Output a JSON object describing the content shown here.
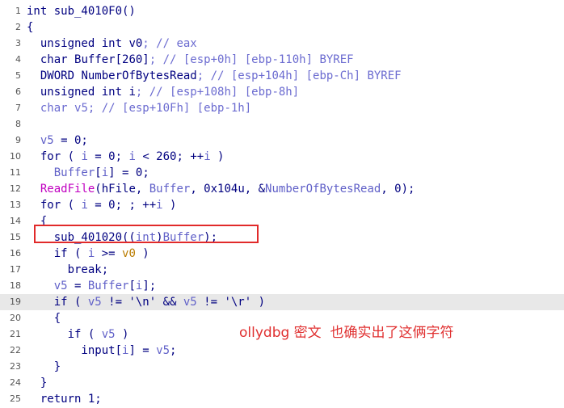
{
  "lines": [
    {
      "num": "1",
      "tokens": [
        {
          "t": "int sub_4010F0()",
          "c": "kw"
        }
      ]
    },
    {
      "num": "2",
      "tokens": [
        {
          "t": "{",
          "c": "op"
        }
      ]
    },
    {
      "num": "3",
      "tokens": [
        {
          "t": "  unsigned int ",
          "c": "kw"
        },
        {
          "t": "v0",
          "c": "id"
        },
        {
          "t": "; // eax",
          "c": "cmt"
        }
      ]
    },
    {
      "num": "4",
      "tokens": [
        {
          "t": "  char ",
          "c": "kw"
        },
        {
          "t": "Buffer[260]",
          "c": "id"
        },
        {
          "t": "; // [esp+0h] [ebp-110h] BYREF",
          "c": "cmt"
        }
      ]
    },
    {
      "num": "5",
      "tokens": [
        {
          "t": "  DWORD ",
          "c": "kw"
        },
        {
          "t": "NumberOfBytesRead",
          "c": "id"
        },
        {
          "t": "; // [esp+104h] [ebp-Ch] BYREF",
          "c": "cmt"
        }
      ]
    },
    {
      "num": "6",
      "tokens": [
        {
          "t": "  unsigned int ",
          "c": "kw"
        },
        {
          "t": "i",
          "c": "id"
        },
        {
          "t": "; // [esp+108h] [ebp-8h]",
          "c": "cmt"
        }
      ]
    },
    {
      "num": "7",
      "tokens": [
        {
          "t": "  char ",
          "c": "cmt"
        },
        {
          "t": "v5",
          "c": "cmt"
        },
        {
          "t": "; // [esp+10Fh] [ebp-1h]",
          "c": "cmt"
        }
      ]
    },
    {
      "num": "8",
      "tokens": []
    },
    {
      "num": "9",
      "tokens": [
        {
          "t": "  ",
          "c": "op"
        },
        {
          "t": "v5",
          "c": "var"
        },
        {
          "t": " = 0;",
          "c": "op"
        }
      ]
    },
    {
      "num": "10",
      "tokens": [
        {
          "t": "  for ( ",
          "c": "kw"
        },
        {
          "t": "i",
          "c": "var"
        },
        {
          "t": " = 0; ",
          "c": "op"
        },
        {
          "t": "i",
          "c": "var"
        },
        {
          "t": " < 260; ++",
          "c": "op"
        },
        {
          "t": "i",
          "c": "var"
        },
        {
          "t": " )",
          "c": "op"
        }
      ]
    },
    {
      "num": "11",
      "tokens": [
        {
          "t": "    ",
          "c": "op"
        },
        {
          "t": "Buffer",
          "c": "var"
        },
        {
          "t": "[",
          "c": "op"
        },
        {
          "t": "i",
          "c": "var"
        },
        {
          "t": "] = 0;",
          "c": "op"
        }
      ]
    },
    {
      "num": "12",
      "tokens": [
        {
          "t": "  ",
          "c": "op"
        },
        {
          "t": "ReadFile",
          "c": "ext"
        },
        {
          "t": "(hFile, ",
          "c": "op"
        },
        {
          "t": "Buffer",
          "c": "var"
        },
        {
          "t": ", 0x104u, &",
          "c": "op"
        },
        {
          "t": "NumberOfBytesRead",
          "c": "var"
        },
        {
          "t": ", 0);",
          "c": "op"
        }
      ]
    },
    {
      "num": "13",
      "tokens": [
        {
          "t": "  for ( ",
          "c": "kw"
        },
        {
          "t": "i",
          "c": "var"
        },
        {
          "t": " = 0; ; ++",
          "c": "op"
        },
        {
          "t": "i",
          "c": "var"
        },
        {
          "t": " )",
          "c": "op"
        }
      ]
    },
    {
      "num": "14",
      "tokens": [
        {
          "t": "  {",
          "c": "op"
        }
      ]
    },
    {
      "num": "15",
      "tokens": [
        {
          "t": "    sub_401020((",
          "c": "fn"
        },
        {
          "t": "int",
          "c": "var"
        },
        {
          "t": ")",
          "c": "op"
        },
        {
          "t": "Buffer",
          "c": "var"
        },
        {
          "t": ");",
          "c": "op"
        }
      ]
    },
    {
      "num": "16",
      "tokens": [
        {
          "t": "    if ( ",
          "c": "kw"
        },
        {
          "t": "i",
          "c": "var"
        },
        {
          "t": " >= ",
          "c": "op"
        },
        {
          "t": "v0",
          "c": "lv"
        },
        {
          "t": " )",
          "c": "op"
        }
      ]
    },
    {
      "num": "17",
      "tokens": [
        {
          "t": "      break;",
          "c": "kw"
        }
      ]
    },
    {
      "num": "18",
      "tokens": [
        {
          "t": "    ",
          "c": "op"
        },
        {
          "t": "v5",
          "c": "var"
        },
        {
          "t": " = ",
          "c": "op"
        },
        {
          "t": "Buffer",
          "c": "var"
        },
        {
          "t": "[",
          "c": "op"
        },
        {
          "t": "i",
          "c": "var"
        },
        {
          "t": "];",
          "c": "op"
        }
      ]
    },
    {
      "num": "19",
      "hl": true,
      "tokens": [
        {
          "t": "    if ( ",
          "c": "kw"
        },
        {
          "t": "v5",
          "c": "var"
        },
        {
          "t": " != '\\n' && ",
          "c": "op"
        },
        {
          "t": "v5",
          "c": "var"
        },
        {
          "t": " != '\\r' )",
          "c": "op"
        }
      ]
    },
    {
      "num": "20",
      "tokens": [
        {
          "t": "    {",
          "c": "op"
        }
      ]
    },
    {
      "num": "21",
      "tokens": [
        {
          "t": "      if ( ",
          "c": "kw"
        },
        {
          "t": "v5",
          "c": "var"
        },
        {
          "t": " )",
          "c": "op"
        }
      ]
    },
    {
      "num": "22",
      "tokens": [
        {
          "t": "        input[",
          "c": "id"
        },
        {
          "t": "i",
          "c": "var"
        },
        {
          "t": "] = ",
          "c": "op"
        },
        {
          "t": "v5",
          "c": "var"
        },
        {
          "t": ";",
          "c": "op"
        }
      ]
    },
    {
      "num": "23",
      "tokens": [
        {
          "t": "    }",
          "c": "op"
        }
      ]
    },
    {
      "num": "24",
      "tokens": [
        {
          "t": "  }",
          "c": "op"
        }
      ]
    },
    {
      "num": "25",
      "tokens": [
        {
          "t": "  return 1;",
          "c": "kw"
        }
      ]
    }
  ],
  "annotation": "ollydbg 密文  也确实出了这俩字符",
  "colors": {
    "highlight_box": "#e12a2a",
    "annotation": "#e03030",
    "current_line": "#e8e8e8"
  }
}
